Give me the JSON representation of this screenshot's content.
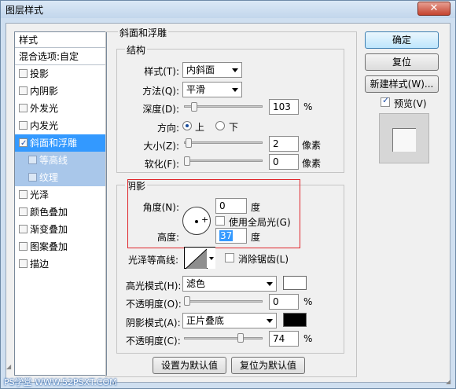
{
  "window": {
    "title": "图层样式",
    "close_label": "✕"
  },
  "sidebar": {
    "header": "样式",
    "blend_options": "混合选项:自定",
    "items": [
      {
        "label": "投影",
        "checked": false
      },
      {
        "label": "内阴影",
        "checked": false
      },
      {
        "label": "外发光",
        "checked": false
      },
      {
        "label": "内发光",
        "checked": false
      },
      {
        "label": "斜面和浮雕",
        "checked": true
      },
      {
        "label": "等高线",
        "checked": false
      },
      {
        "label": "纹理",
        "checked": false
      },
      {
        "label": "光泽",
        "checked": false
      },
      {
        "label": "颜色叠加",
        "checked": false
      },
      {
        "label": "渐变叠加",
        "checked": false
      },
      {
        "label": "图案叠加",
        "checked": false
      },
      {
        "label": "描边",
        "checked": false
      }
    ]
  },
  "bevel": {
    "group_title": "斜面和浮雕",
    "structure": {
      "title": "结构",
      "style_label": "样式(T):",
      "style_value": "内斜面",
      "technique_label": "方法(Q):",
      "technique_value": "平滑",
      "depth_label": "深度(D):",
      "depth_value": "103",
      "depth_unit": "%",
      "depth_level": 0.1,
      "direction_label": "方向:",
      "direction_up": "上",
      "direction_down": "下",
      "size_label": "大小(Z):",
      "size_value": "2",
      "size_unit": "像素",
      "size_level": 0.02,
      "soften_label": "软化(F):",
      "soften_value": "0",
      "soften_unit": "像素",
      "soften_level": 0.0
    },
    "shading": {
      "title": "阴影",
      "angle_label": "角度(N):",
      "angle_value": "0",
      "angle_unit": "度",
      "global_light_label": "使用全局光(G)",
      "altitude_label": "高度:",
      "altitude_value": "37",
      "altitude_unit": "度",
      "gloss_contour_label": "光泽等高线:",
      "antialias_label": "消除锯齿(L)",
      "highlight_mode_label": "高光模式(H):",
      "highlight_mode_value": "滤色",
      "highlight_color": "#ffffff",
      "highlight_opacity_label": "不透明度(O):",
      "highlight_opacity_value": "0",
      "highlight_opacity_unit": "%",
      "highlight_opacity_level": 0.0,
      "shadow_mode_label": "阴影模式(A):",
      "shadow_mode_value": "正片叠底",
      "shadow_color": "#000000",
      "shadow_opacity_label": "不透明度(C):",
      "shadow_opacity_value": "74",
      "shadow_opacity_unit": "%",
      "shadow_opacity_level": 0.74
    },
    "make_default": "设置为默认值",
    "reset_default": "复位为默认值"
  },
  "buttons": {
    "ok": "确定",
    "reset": "复位",
    "new_style": "新建样式(W)...",
    "preview_label": "预览(V)"
  },
  "watermark": "PS学堂 WWW.52PSXT.COM"
}
